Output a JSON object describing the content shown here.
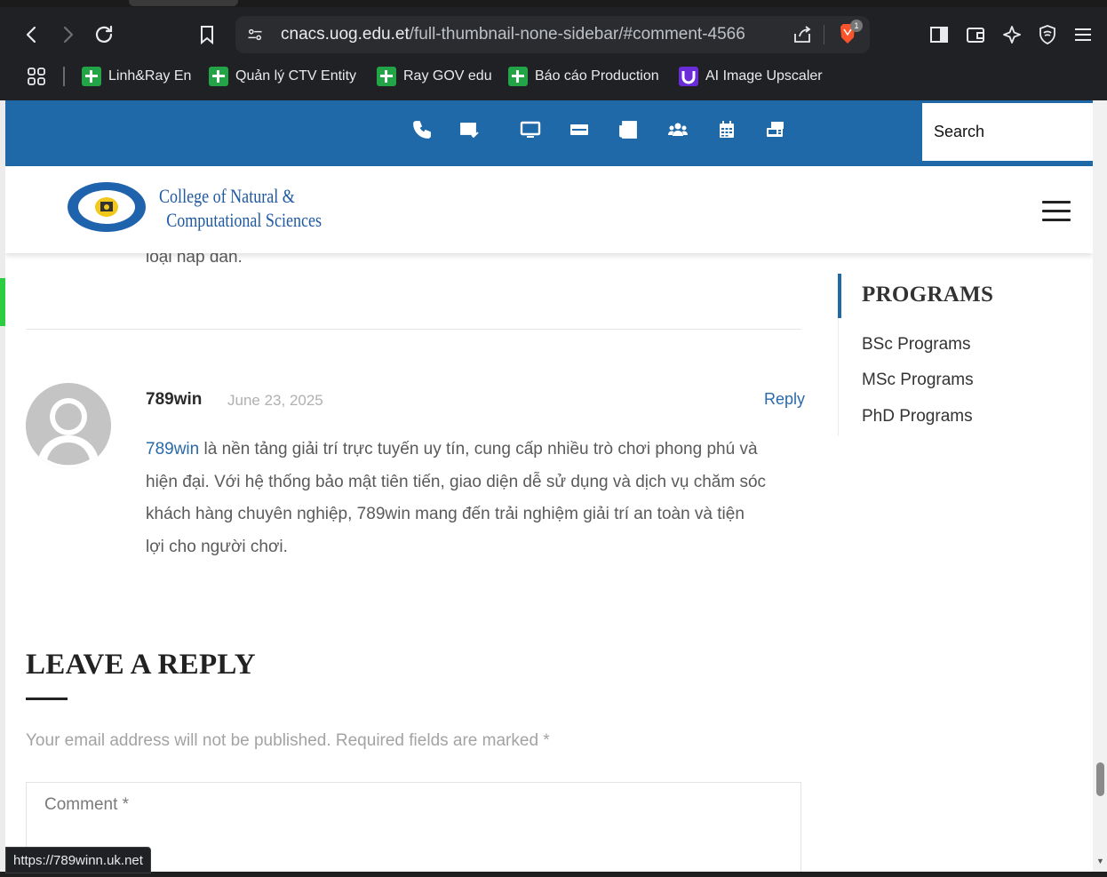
{
  "browser": {
    "url_host": "cnacs.uog.edu.et",
    "url_path": "/full-thumbnail-none-sidebar/#comment-4566",
    "brave_badge_count": "1",
    "bookmarks": [
      {
        "label": "Linh&Ray En",
        "icon": "sheets-icon"
      },
      {
        "label": "Quản lý CTV Entity",
        "icon": "sheets-icon"
      },
      {
        "label": "Ray GOV edu",
        "icon": "sheets-icon"
      },
      {
        "label": "Báo cáo Production",
        "icon": "sheets-icon"
      },
      {
        "label": "AI Image Upscaler",
        "icon": "upscaler-icon"
      }
    ],
    "status_url": "https://789winn.uk.net"
  },
  "site": {
    "topbar_icons": [
      "phone-icon",
      "mail-icon",
      "desktop-icon",
      "id-card-icon",
      "newspaper-icon",
      "users-icon",
      "calendar-icon",
      "fax-icon"
    ],
    "search_placeholder": "Search",
    "logo_line1": "College of Natural &",
    "logo_line2": "Computational Sciences",
    "colors": {
      "brand_blue": "#1f69a9",
      "link_blue": "#2a6aa8"
    }
  },
  "main": {
    "previous_comment_tail": "loại hấp dẫn.",
    "comment": {
      "author": "789win",
      "date": "June 23, 2025",
      "reply_label": "Reply",
      "link_text": "789win",
      "body_rest": " là nền tảng giải trí trực tuyến uy tín, cung cấp nhiều trò chơi phong phú và hiện đại. Với hệ thống bảo mật tiên tiến, giao diện dễ sử dụng và dịch vụ chăm sóc khách hàng chuyên nghiệp, 789win mang đến trải nghiệm giải trí an toàn và tiện lợi cho người chơi."
    },
    "leave_reply_title": "LEAVE A REPLY",
    "notes": "Your email address will not be published. Required fields are marked *",
    "comment_placeholder": "Comment *"
  },
  "sidebar": {
    "title": "PROGRAMS",
    "items": [
      {
        "label": "BSc Programs"
      },
      {
        "label": "MSc Programs"
      },
      {
        "label": "PhD Programs"
      }
    ]
  }
}
